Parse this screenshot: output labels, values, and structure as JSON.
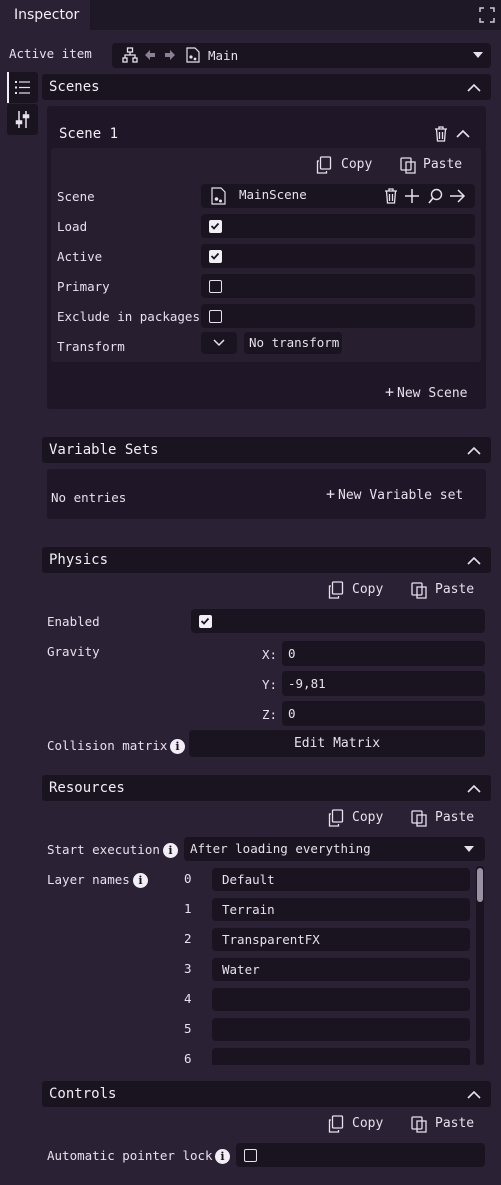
{
  "tab": {
    "title": "Inspector"
  },
  "active_item": {
    "label": "Active item",
    "value": "Main"
  },
  "scenes": {
    "header": "Scenes",
    "scene": {
      "title": "Scene 1",
      "copy": "Copy",
      "paste": "Paste",
      "rows": {
        "scene_label": "Scene",
        "scene_value": "MainScene",
        "load_label": "Load",
        "load_checked": true,
        "active_label": "Active",
        "active_checked": true,
        "primary_label": "Primary",
        "primary_checked": false,
        "exclude_label": "Exclude in packages",
        "exclude_checked": false,
        "transform_label": "Transform",
        "transform_value": "No transform"
      }
    },
    "new_scene": "New Scene"
  },
  "variable_sets": {
    "header": "Variable Sets",
    "empty": "No entries",
    "new": "New Variable set"
  },
  "physics": {
    "header": "Physics",
    "copy": "Copy",
    "paste": "Paste",
    "enabled_label": "Enabled",
    "enabled_checked": true,
    "gravity_label": "Gravity",
    "x_label": "X:",
    "x_value": "0",
    "y_label": "Y:",
    "y_value": "-9,81",
    "z_label": "Z:",
    "z_value": "0",
    "collision_label": "Collision matrix",
    "edit_matrix": "Edit Matrix"
  },
  "resources": {
    "header": "Resources",
    "copy": "Copy",
    "paste": "Paste",
    "start_label": "Start execution",
    "start_value": "After loading everything",
    "layer_label": "Layer names",
    "layers": [
      {
        "index": "0",
        "name": "Default"
      },
      {
        "index": "1",
        "name": "Terrain"
      },
      {
        "index": "2",
        "name": "TransparentFX"
      },
      {
        "index": "3",
        "name": "Water"
      },
      {
        "index": "4",
        "name": ""
      },
      {
        "index": "5",
        "name": ""
      },
      {
        "index": "6",
        "name": ""
      }
    ]
  },
  "controls": {
    "header": "Controls",
    "copy": "Copy",
    "paste": "Paste",
    "pointer_label": "Automatic pointer lock",
    "pointer_checked": false
  },
  "colors": {
    "background": "#2b2135",
    "field": "#1a1320",
    "panel": "#1f1727",
    "text": "#e6e1ec"
  }
}
